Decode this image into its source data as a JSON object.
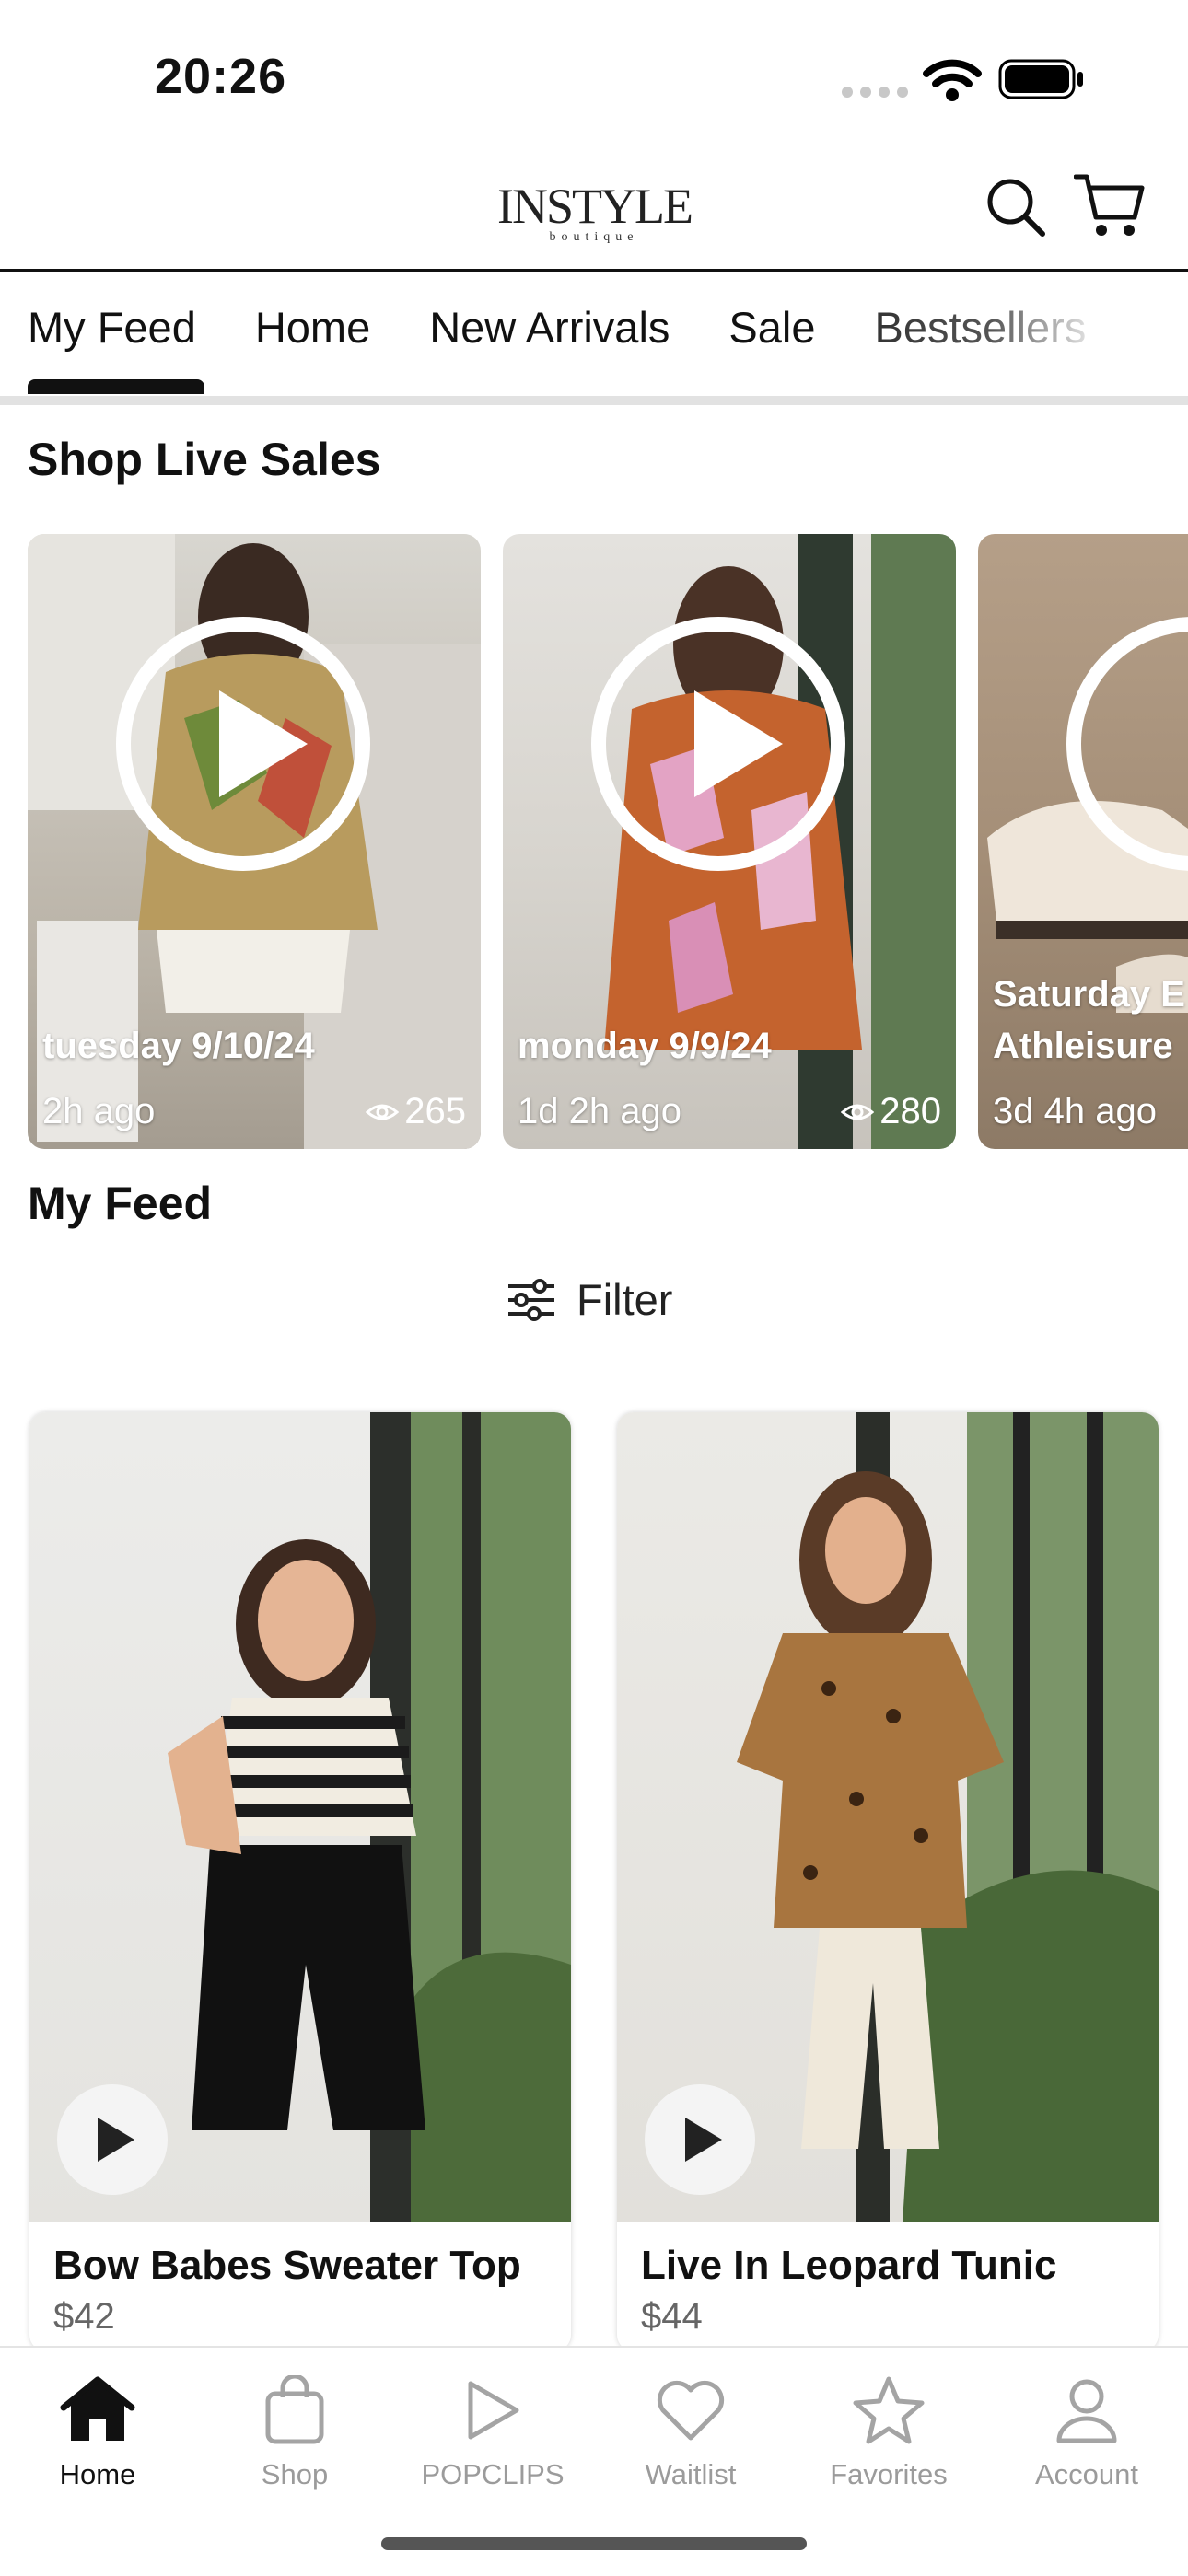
{
  "status_bar": {
    "time": "20:26"
  },
  "header": {
    "logo_main": "INSTYLE",
    "logo_sub": "boutique"
  },
  "tabs": [
    "My Feed",
    "Home",
    "New Arrivals",
    "Sale",
    "Bestsellers"
  ],
  "active_tab": "My Feed",
  "live_sales": {
    "title": "Shop Live Sales",
    "cards": [
      {
        "date": "tuesday 9/10/24",
        "ago": "2h ago",
        "views": "265"
      },
      {
        "date": "monday 9/9/24",
        "ago": "1d 2h ago",
        "views": "280"
      },
      {
        "date": "Saturday E",
        "date_line2": "Athleisure",
        "ago": "3d 4h ago"
      }
    ]
  },
  "feed": {
    "title": "My Feed",
    "filter_label": "Filter",
    "products": [
      {
        "name": "Bow Babes Sweater Top",
        "price": "$42"
      },
      {
        "name": "Live In Leopard Tunic",
        "price": "$44"
      }
    ]
  },
  "bottom_nav": {
    "items": [
      {
        "label": "Home",
        "icon": "home-icon",
        "active": true
      },
      {
        "label": "Shop",
        "icon": "shopping-bag-icon"
      },
      {
        "label": "POPCLIPS",
        "icon": "play-icon"
      },
      {
        "label": "Waitlist",
        "icon": "heart-icon"
      },
      {
        "label": "Favorites",
        "icon": "star-icon"
      },
      {
        "label": "Account",
        "icon": "person-icon"
      }
    ]
  }
}
